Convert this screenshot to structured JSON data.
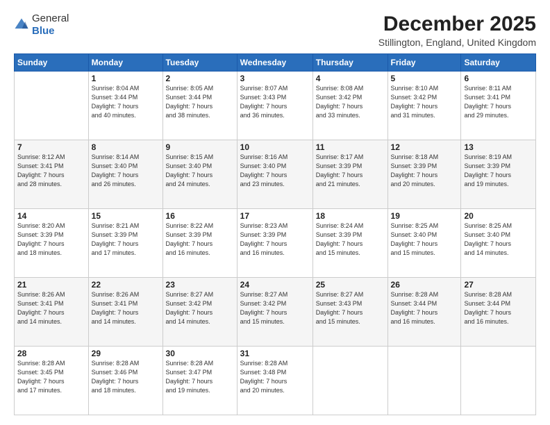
{
  "header": {
    "logo_general": "General",
    "logo_blue": "Blue",
    "month_title": "December 2025",
    "location": "Stillington, England, United Kingdom"
  },
  "days_of_week": [
    "Sunday",
    "Monday",
    "Tuesday",
    "Wednesday",
    "Thursday",
    "Friday",
    "Saturday"
  ],
  "weeks": [
    [
      {
        "day": "",
        "info": ""
      },
      {
        "day": "1",
        "info": "Sunrise: 8:04 AM\nSunset: 3:44 PM\nDaylight: 7 hours\nand 40 minutes."
      },
      {
        "day": "2",
        "info": "Sunrise: 8:05 AM\nSunset: 3:44 PM\nDaylight: 7 hours\nand 38 minutes."
      },
      {
        "day": "3",
        "info": "Sunrise: 8:07 AM\nSunset: 3:43 PM\nDaylight: 7 hours\nand 36 minutes."
      },
      {
        "day": "4",
        "info": "Sunrise: 8:08 AM\nSunset: 3:42 PM\nDaylight: 7 hours\nand 33 minutes."
      },
      {
        "day": "5",
        "info": "Sunrise: 8:10 AM\nSunset: 3:42 PM\nDaylight: 7 hours\nand 31 minutes."
      },
      {
        "day": "6",
        "info": "Sunrise: 8:11 AM\nSunset: 3:41 PM\nDaylight: 7 hours\nand 29 minutes."
      }
    ],
    [
      {
        "day": "7",
        "info": "Sunrise: 8:12 AM\nSunset: 3:41 PM\nDaylight: 7 hours\nand 28 minutes."
      },
      {
        "day": "8",
        "info": "Sunrise: 8:14 AM\nSunset: 3:40 PM\nDaylight: 7 hours\nand 26 minutes."
      },
      {
        "day": "9",
        "info": "Sunrise: 8:15 AM\nSunset: 3:40 PM\nDaylight: 7 hours\nand 24 minutes."
      },
      {
        "day": "10",
        "info": "Sunrise: 8:16 AM\nSunset: 3:40 PM\nDaylight: 7 hours\nand 23 minutes."
      },
      {
        "day": "11",
        "info": "Sunrise: 8:17 AM\nSunset: 3:39 PM\nDaylight: 7 hours\nand 21 minutes."
      },
      {
        "day": "12",
        "info": "Sunrise: 8:18 AM\nSunset: 3:39 PM\nDaylight: 7 hours\nand 20 minutes."
      },
      {
        "day": "13",
        "info": "Sunrise: 8:19 AM\nSunset: 3:39 PM\nDaylight: 7 hours\nand 19 minutes."
      }
    ],
    [
      {
        "day": "14",
        "info": "Sunrise: 8:20 AM\nSunset: 3:39 PM\nDaylight: 7 hours\nand 18 minutes."
      },
      {
        "day": "15",
        "info": "Sunrise: 8:21 AM\nSunset: 3:39 PM\nDaylight: 7 hours\nand 17 minutes."
      },
      {
        "day": "16",
        "info": "Sunrise: 8:22 AM\nSunset: 3:39 PM\nDaylight: 7 hours\nand 16 minutes."
      },
      {
        "day": "17",
        "info": "Sunrise: 8:23 AM\nSunset: 3:39 PM\nDaylight: 7 hours\nand 16 minutes."
      },
      {
        "day": "18",
        "info": "Sunrise: 8:24 AM\nSunset: 3:39 PM\nDaylight: 7 hours\nand 15 minutes."
      },
      {
        "day": "19",
        "info": "Sunrise: 8:25 AM\nSunset: 3:40 PM\nDaylight: 7 hours\nand 15 minutes."
      },
      {
        "day": "20",
        "info": "Sunrise: 8:25 AM\nSunset: 3:40 PM\nDaylight: 7 hours\nand 14 minutes."
      }
    ],
    [
      {
        "day": "21",
        "info": "Sunrise: 8:26 AM\nSunset: 3:41 PM\nDaylight: 7 hours\nand 14 minutes."
      },
      {
        "day": "22",
        "info": "Sunrise: 8:26 AM\nSunset: 3:41 PM\nDaylight: 7 hours\nand 14 minutes."
      },
      {
        "day": "23",
        "info": "Sunrise: 8:27 AM\nSunset: 3:42 PM\nDaylight: 7 hours\nand 14 minutes."
      },
      {
        "day": "24",
        "info": "Sunrise: 8:27 AM\nSunset: 3:42 PM\nDaylight: 7 hours\nand 15 minutes."
      },
      {
        "day": "25",
        "info": "Sunrise: 8:27 AM\nSunset: 3:43 PM\nDaylight: 7 hours\nand 15 minutes."
      },
      {
        "day": "26",
        "info": "Sunrise: 8:28 AM\nSunset: 3:44 PM\nDaylight: 7 hours\nand 16 minutes."
      },
      {
        "day": "27",
        "info": "Sunrise: 8:28 AM\nSunset: 3:44 PM\nDaylight: 7 hours\nand 16 minutes."
      }
    ],
    [
      {
        "day": "28",
        "info": "Sunrise: 8:28 AM\nSunset: 3:45 PM\nDaylight: 7 hours\nand 17 minutes."
      },
      {
        "day": "29",
        "info": "Sunrise: 8:28 AM\nSunset: 3:46 PM\nDaylight: 7 hours\nand 18 minutes."
      },
      {
        "day": "30",
        "info": "Sunrise: 8:28 AM\nSunset: 3:47 PM\nDaylight: 7 hours\nand 19 minutes."
      },
      {
        "day": "31",
        "info": "Sunrise: 8:28 AM\nSunset: 3:48 PM\nDaylight: 7 hours\nand 20 minutes."
      },
      {
        "day": "",
        "info": ""
      },
      {
        "day": "",
        "info": ""
      },
      {
        "day": "",
        "info": ""
      }
    ]
  ]
}
